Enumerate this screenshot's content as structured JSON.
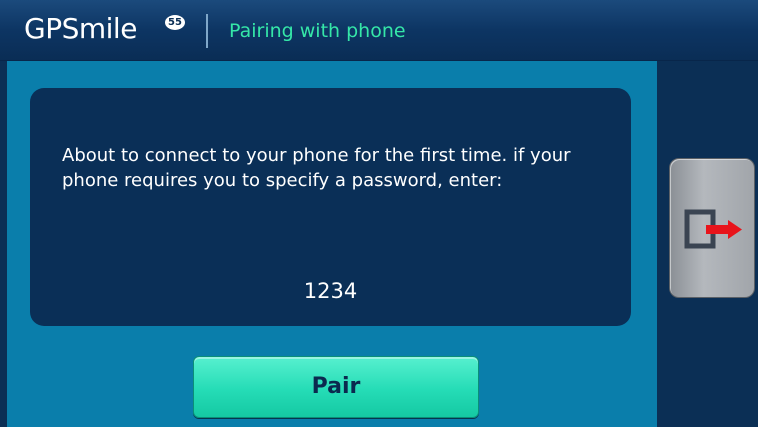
{
  "header": {
    "logo_text": "GPSmile",
    "logo_badge": "55",
    "title": "Pairing with phone"
  },
  "dialog": {
    "message": "About to connect to your phone for the first time. if your phone requires you to specify a password, enter:",
    "pin": "1234"
  },
  "actions": {
    "pair_label": "Pair",
    "exit_icon": "exit-door-arrow-icon"
  },
  "colors": {
    "header_bg": "#0d3563",
    "title_color": "#35e7a8",
    "main_bg": "#0a7eab",
    "message_box_bg": "#0a2f57",
    "pair_button_bg": "#25dcb6",
    "exit_arrow": "#e8141b"
  }
}
